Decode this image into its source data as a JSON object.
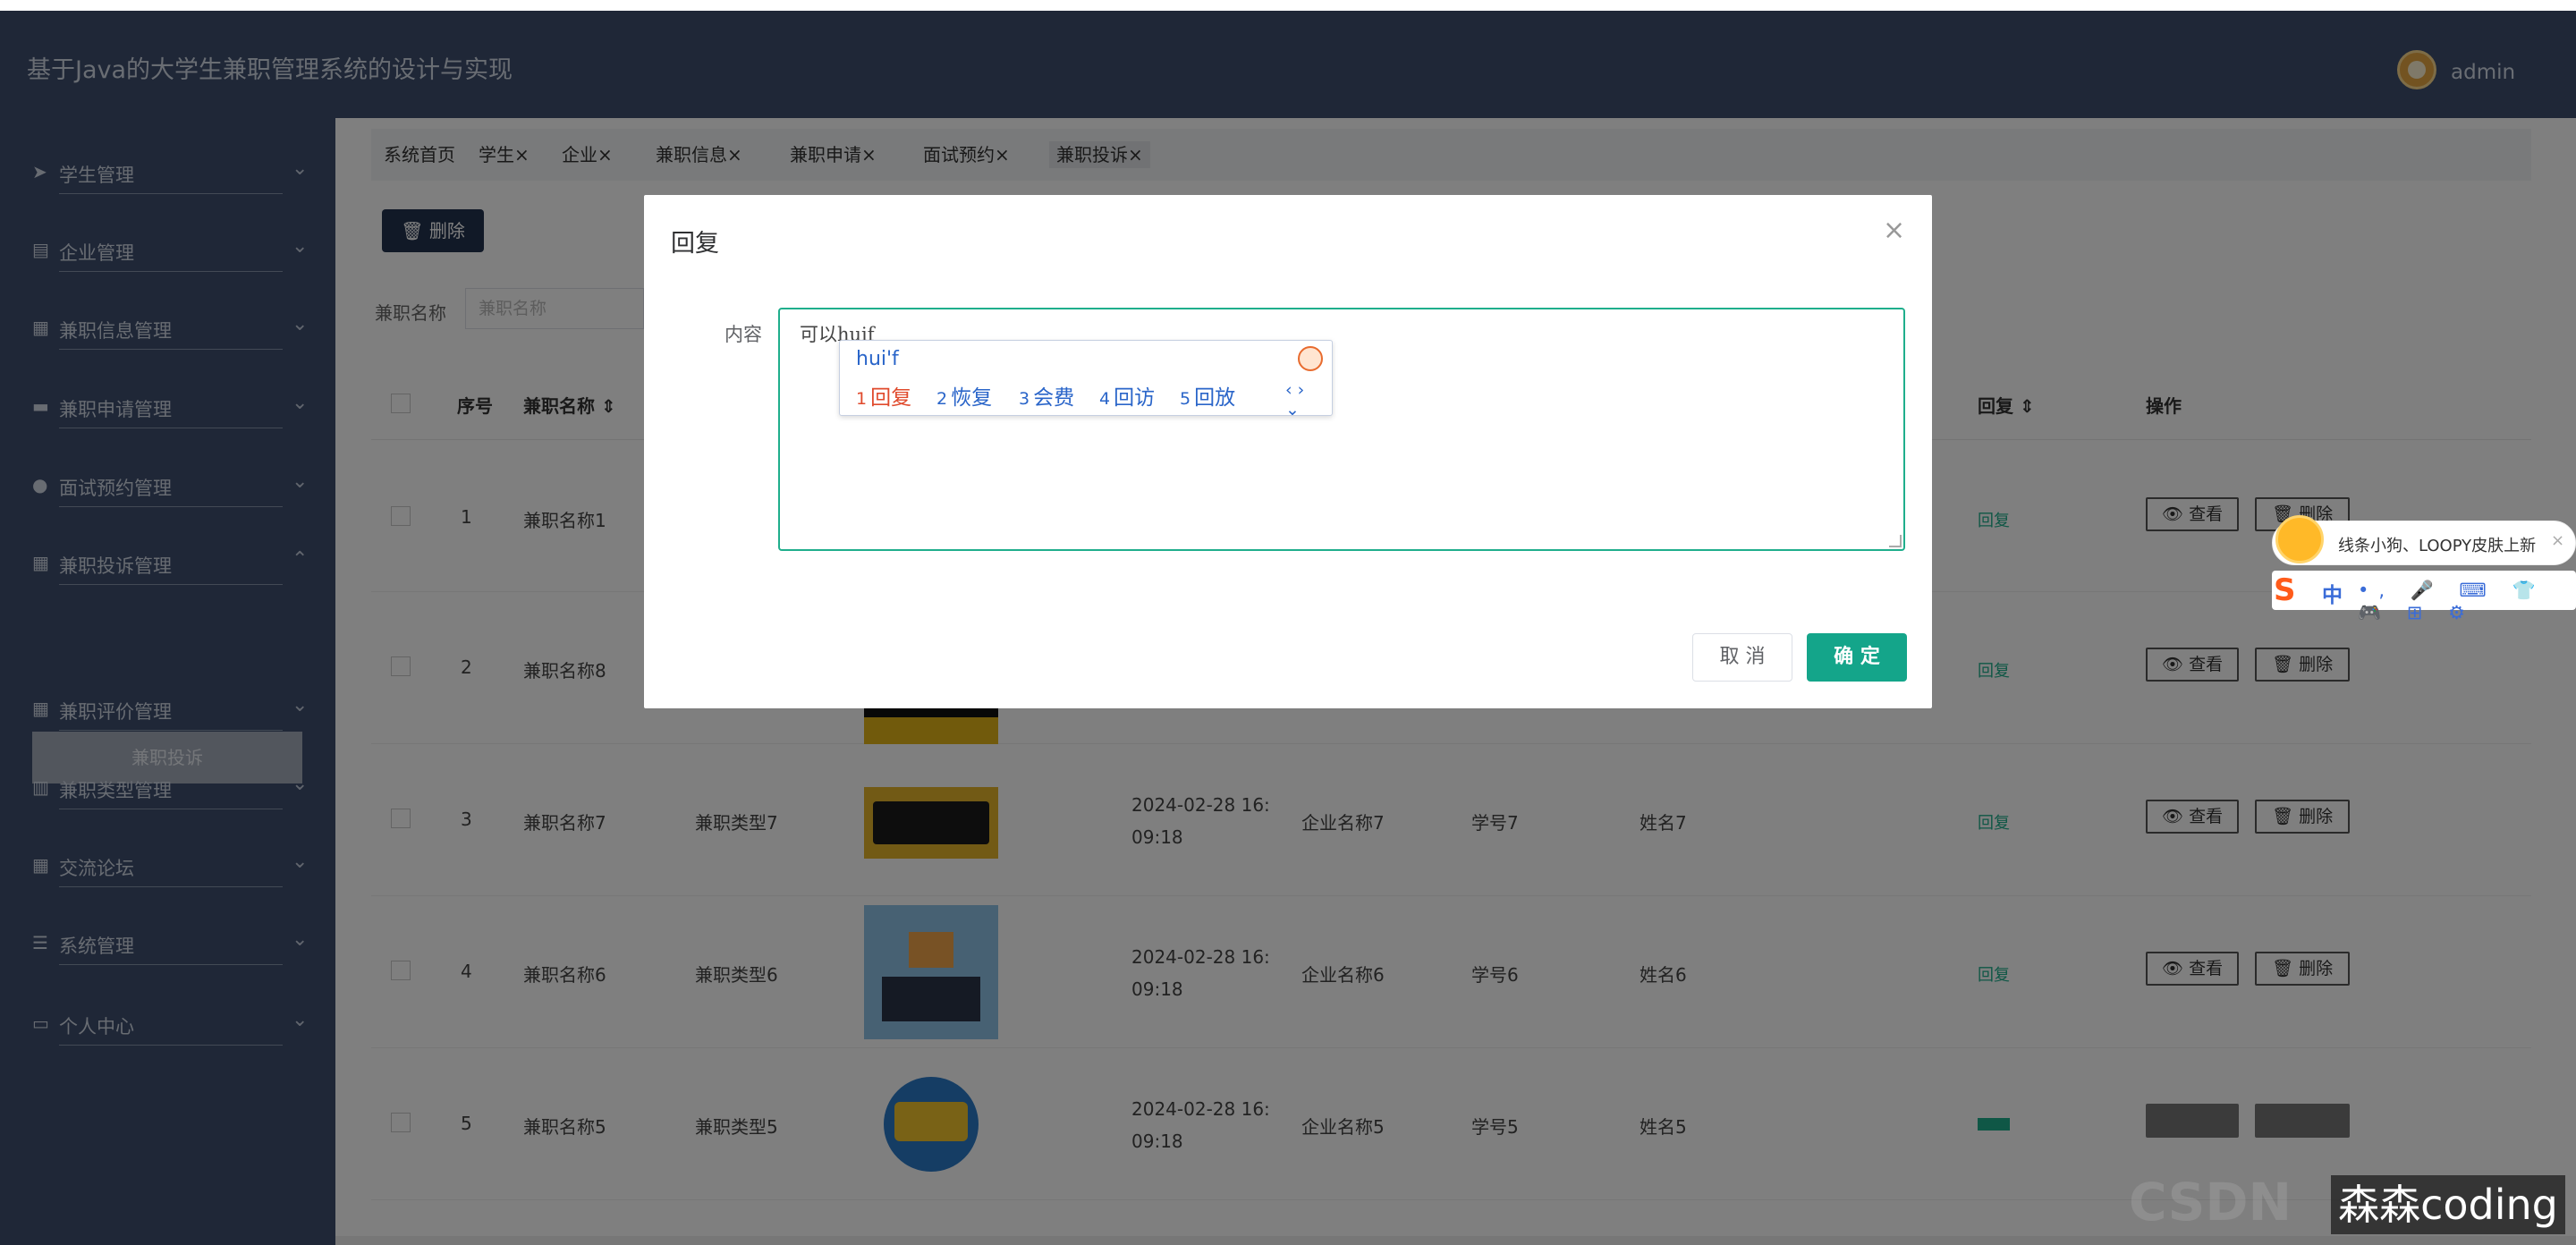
{
  "app": {
    "title": "基于Java的大学生兼职管理系统的设计与实现",
    "user": "admin"
  },
  "sidebar": {
    "items": [
      {
        "icon": "paper-plane-icon",
        "glyph": "➤",
        "label": "学生管理",
        "expanded": false
      },
      {
        "icon": "building-icon",
        "glyph": "▤",
        "label": "企业管理",
        "expanded": false
      },
      {
        "icon": "grid-icon",
        "glyph": "▦",
        "label": "兼职信息管理",
        "expanded": false
      },
      {
        "icon": "book-icon",
        "glyph": "▬",
        "label": "兼职申请管理",
        "expanded": false
      },
      {
        "icon": "user-icon",
        "glyph": "●",
        "label": "面试预约管理",
        "expanded": false
      },
      {
        "icon": "grid-icon",
        "glyph": "▦",
        "label": "兼职投诉管理",
        "expanded": true
      },
      {
        "icon": "grid-icon",
        "glyph": "▦",
        "label": "兼职评价管理",
        "expanded": false
      },
      {
        "icon": "bar-chart-icon",
        "glyph": "▥",
        "label": "兼职类型管理",
        "expanded": false
      },
      {
        "icon": "grid-icon",
        "glyph": "▦",
        "label": "交流论坛",
        "expanded": false
      },
      {
        "icon": "list-icon",
        "glyph": "☰",
        "label": "系统管理",
        "expanded": false
      },
      {
        "icon": "id-card-icon",
        "glyph": "▭",
        "label": "个人中心",
        "expanded": false
      }
    ],
    "active_subitem": "兼职投诉"
  },
  "tabs": [
    {
      "label": "系统首页",
      "closable": false,
      "active": false
    },
    {
      "label": "学生×",
      "closable": true,
      "active": false
    },
    {
      "label": "企业×",
      "closable": true,
      "active": false
    },
    {
      "label": "兼职信息×",
      "closable": true,
      "active": false
    },
    {
      "label": "兼职申请×",
      "closable": true,
      "active": false
    },
    {
      "label": "面试预约×",
      "closable": true,
      "active": false
    },
    {
      "label": "兼职投诉×",
      "closable": true,
      "active": true
    }
  ],
  "toolbar": {
    "delete_label": "🗑 删除"
  },
  "search": {
    "label": "兼职名称",
    "placeholder": "兼职名称"
  },
  "table": {
    "headers": {
      "index": "序号",
      "name": "兼职名称 ⇕",
      "reply": "回复 ⇕",
      "actions": "操作"
    },
    "rows": [
      {
        "index": "1",
        "name": "兼职名称1",
        "type": "",
        "date_line1": "",
        "date_line2": "",
        "company": "",
        "student_no": "",
        "student_name": "",
        "reply": "回复",
        "view": "👁 查看",
        "delete": "🗑 删除"
      },
      {
        "index": "2",
        "name": "兼职名称8",
        "type": "",
        "date_line1": "",
        "date_line2": "",
        "company": "",
        "student_no": "",
        "student_name": "",
        "reply": "回复",
        "view": "👁 查看",
        "delete": "🗑 删除"
      },
      {
        "index": "3",
        "name": "兼职名称7",
        "type": "兼职类型7",
        "date_line1": "2024-02-28 16:",
        "date_line2": "09:18",
        "company": "企业名称7",
        "student_no": "学号7",
        "student_name": "姓名7",
        "reply": "回复",
        "view": "👁 查看",
        "delete": "🗑 删除"
      },
      {
        "index": "4",
        "name": "兼职名称6",
        "type": "兼职类型6",
        "date_line1": "2024-02-28 16:",
        "date_line2": "09:18",
        "company": "企业名称6",
        "student_no": "学号6",
        "student_name": "姓名6",
        "reply": "回复",
        "view": "👁 查看",
        "delete": "🗑 删除"
      },
      {
        "index": "5",
        "name": "兼职名称5",
        "type": "兼职类型5",
        "date_line1": "2024-02-28 16:",
        "date_line2": "09:18",
        "company": "企业名称5",
        "student_no": "学号5",
        "student_name": "姓名5",
        "reply": "",
        "view": "",
        "delete": ""
      }
    ]
  },
  "dialog": {
    "title": "回复",
    "close_glyph": "×",
    "content_label": "内容",
    "content_value": "可以huif",
    "cancel_label": "取 消",
    "ok_label": "确 定"
  },
  "ime": {
    "pinyin": "hui'f",
    "candidates": [
      {
        "num": "1",
        "text": "回复"
      },
      {
        "num": "2",
        "text": "恢复"
      },
      {
        "num": "3",
        "text": "会费"
      },
      {
        "num": "4",
        "text": "回访"
      },
      {
        "num": "5",
        "text": "回放"
      }
    ],
    "nav": "‹ › ⌄"
  },
  "sogou": {
    "ad_text": "线条小狗、LOOPY皮肤上新",
    "ad_close": "×",
    "logo": "S",
    "lang": "中",
    "icons": "•, 🎤 ⌨ 👕 🎮 ⊞ ⚙"
  },
  "watermark": {
    "text": "森森coding"
  },
  "colors": {
    "sidebar_bg": "#3e4e6f",
    "accent": "#14a58a",
    "ime_blue": "#2a65c9",
    "ime_first": "#e04a2c"
  }
}
